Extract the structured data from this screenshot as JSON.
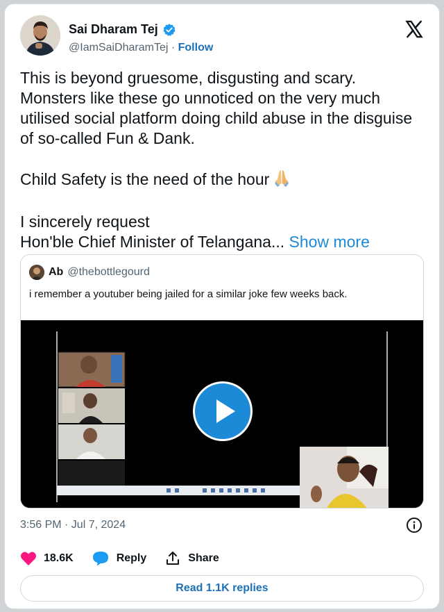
{
  "author": {
    "name": "Sai Dharam Tej",
    "handle": "@IamSaiDharamTej",
    "separator": " · ",
    "follow_label": "Follow"
  },
  "tweet": {
    "paragraphs": [
      "This is beyond gruesome, disgusting and scary. Monsters like these go unnoticed on the very much utilised social platform doing child abuse in the disguise of so-called Fun & Dank.",
      "Child Safety is the need of the hour",
      "I sincerely request",
      "Hon'ble Chief Minister of Telangana..."
    ],
    "show_more": "Show more"
  },
  "quote": {
    "name": "Ab",
    "handle": "@thebottlegourd",
    "text": "i remember a youtuber being jailed for a similar joke few weeks back."
  },
  "timestamp": "3:56 PM · Jul 7, 2024",
  "actions": {
    "likes": "18.6K",
    "reply_label": "Reply",
    "share_label": "Share"
  },
  "read_replies_label": "Read 1.1K replies",
  "colors": {
    "link": "#1d70b8",
    "accent": "#1d8ad8",
    "like": "#f91880",
    "muted": "#536471"
  }
}
